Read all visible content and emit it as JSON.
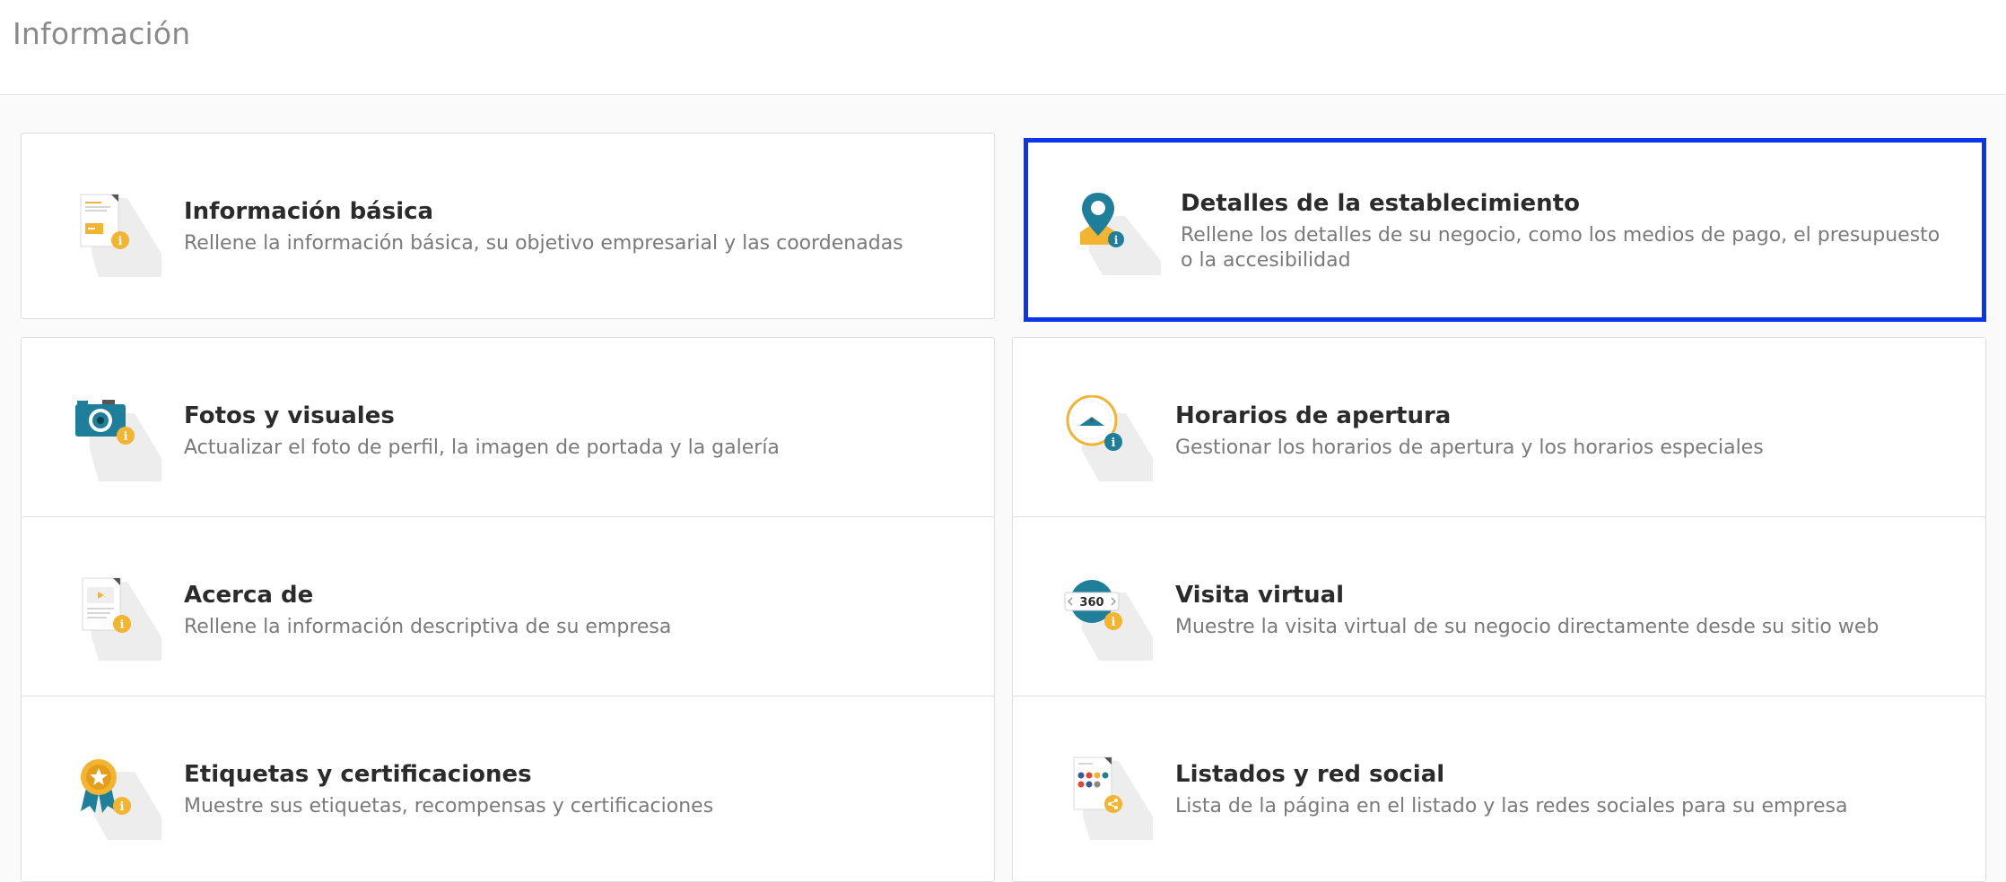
{
  "header": {
    "title": "Información"
  },
  "colors": {
    "accent_yellow": "#f2b431",
    "accent_teal": "#1f7f9a",
    "selection_blue": "#0a35e8"
  },
  "cards": [
    {
      "title": "Información básica",
      "description": "Rellene la información básica, su objetivo empresarial y las coordenadas",
      "icon": "document-info-icon",
      "selected": false
    },
    {
      "title": "Detalles de la establecimiento",
      "description": "Rellene los detalles de su negocio, como los medios de pago, el presupuesto o la accesibilidad",
      "icon": "map-pin-info-icon",
      "selected": true
    },
    {
      "title": "Fotos y visuales",
      "description": "Actualizar el foto de perfil, la imagen de portada y la galería",
      "icon": "camera-info-icon",
      "selected": false
    },
    {
      "title": "Horarios de apertura",
      "description": "Gestionar los horarios de apertura y los horarios especiales",
      "icon": "clock-info-icon",
      "selected": false
    },
    {
      "title": "Acerca de",
      "description": "Rellene la información descriptiva de su empresa",
      "icon": "video-document-info-icon",
      "selected": false
    },
    {
      "title": "Visita virtual",
      "description": "Muestre la visita virtual de su negocio directamente desde su sitio web",
      "icon": "360-tour-info-icon",
      "icon_text": "360",
      "selected": false
    },
    {
      "title": "Etiquetas y certificaciones",
      "description": "Muestre sus etiquetas, recompensas y certificaciones",
      "icon": "award-badge-info-icon",
      "selected": false
    },
    {
      "title": "Listados y red social",
      "description": "Lista de la página en el listado y las redes sociales para su empresa",
      "icon": "social-share-icon",
      "selected": false
    }
  ]
}
